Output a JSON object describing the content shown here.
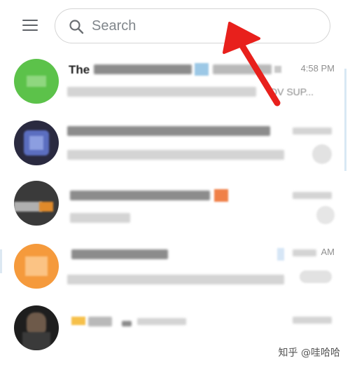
{
  "header": {
    "search_placeholder": "Search"
  },
  "chats": [
    {
      "title_visible": "The",
      "time": "4:58 PM",
      "preview_visible": "DV SUP..."
    },
    {
      "title_visible": "",
      "time": "",
      "preview_visible": ""
    },
    {
      "title_visible": "",
      "time": "",
      "preview_visible": ""
    },
    {
      "title_visible": "",
      "time": "AM",
      "preview_visible": ""
    },
    {
      "title_visible": "",
      "time": "",
      "preview_visible": ""
    }
  ],
  "watermark": "知乎 @哇哈哈",
  "icons": [
    "menu-icon",
    "search-icon",
    "annotation-arrow"
  ],
  "colors": {
    "arrow": "#e8201c",
    "avatar_1": "#5cc24a",
    "avatar_2": "#2a2a40",
    "avatar_3": "#3a3a3a",
    "avatar_4": "#f59a3c",
    "avatar_5": "#1e1e1e",
    "search_border": "#d4d4d4"
  }
}
